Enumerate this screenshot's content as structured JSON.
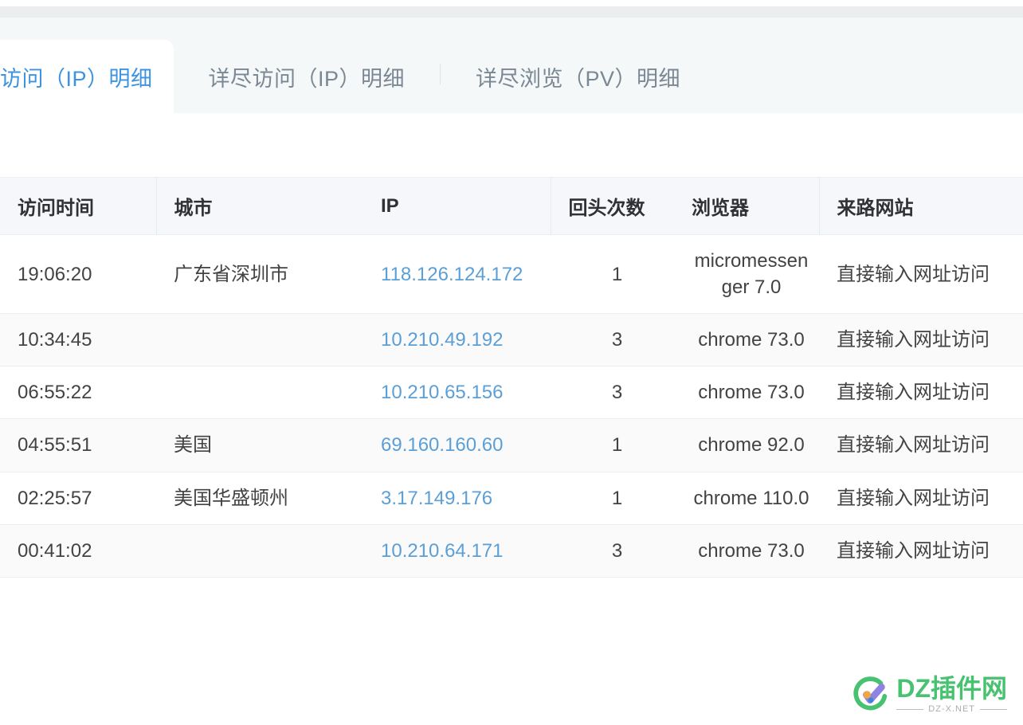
{
  "tabs": [
    {
      "label": "访问（IP）明细",
      "active": true,
      "truncated_left": true
    },
    {
      "label": "详尽访问（IP）明细",
      "active": false
    },
    {
      "label": "详尽浏览（PV）明细",
      "active": false
    }
  ],
  "table": {
    "columns": [
      {
        "key": "time",
        "label": "访问时间"
      },
      {
        "key": "city",
        "label": "城市"
      },
      {
        "key": "ip",
        "label": "IP"
      },
      {
        "key": "returns",
        "label": "回头次数"
      },
      {
        "key": "browser",
        "label": "浏览器"
      },
      {
        "key": "referer",
        "label": "来路网站"
      }
    ],
    "rows": [
      {
        "time": "19:06:20",
        "city": "广东省深圳市",
        "ip": "118.126.124.172",
        "returns": "1",
        "browser": "micromessenger 7.0",
        "referer": "直接输入网址访问"
      },
      {
        "time": "10:34:45",
        "city": "",
        "ip": "10.210.49.192",
        "returns": "3",
        "browser": "chrome 73.0",
        "referer": "直接输入网址访问"
      },
      {
        "time": "06:55:22",
        "city": "",
        "ip": "10.210.65.156",
        "returns": "3",
        "browser": "chrome 73.0",
        "referer": "直接输入网址访问"
      },
      {
        "time": "04:55:51",
        "city": "美国",
        "ip": "69.160.160.60",
        "returns": "1",
        "browser": "chrome 92.0",
        "referer": "直接输入网址访问"
      },
      {
        "time": "02:25:57",
        "city": "美国华盛顿州",
        "ip": "3.17.149.176",
        "returns": "1",
        "browser": "chrome 110.0",
        "referer": "直接输入网址访问"
      },
      {
        "time": "00:41:02",
        "city": "",
        "ip": "10.210.64.171",
        "returns": "3",
        "browser": "chrome 73.0",
        "referer": "直接输入网址访问"
      }
    ]
  },
  "watermark": {
    "title": "DZ插件网",
    "subtitle": "DZ-X.NET",
    "mark_icon": "dz-circle-check-logo-icon"
  },
  "colors": {
    "active_tab_text": "#3d93e0",
    "inactive_tab_text": "#7b8794",
    "link": "#5b9fd6",
    "header_bg": "#f5f7fa",
    "stripe_bg": "#fafafa",
    "tabbar_bg": "#f4f8f8",
    "watermark_green": "#3fbf6a"
  }
}
